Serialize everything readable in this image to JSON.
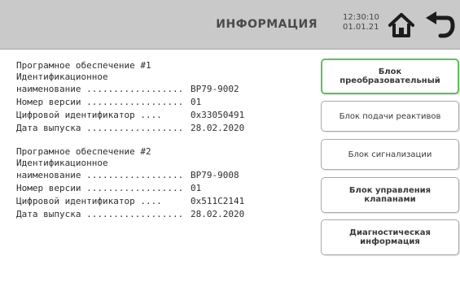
{
  "header": {
    "title": "ИНФОРМАЦИЯ",
    "time": "12:30:10",
    "date": "01.01.21"
  },
  "software": [
    {
      "title": "Програмное обеспечение #1",
      "name_label_line1": "Идентификационное",
      "rows": [
        {
          "label": "наименование ..................",
          "value": "ВР79-9002"
        },
        {
          "label": "Номер версии ..................",
          "value": "01"
        },
        {
          "label": "Цифровой идентификатор ....",
          "value": "0x33050491"
        },
        {
          "label": "Дата выпуска ..................",
          "value": "28.02.2020"
        }
      ]
    },
    {
      "title": "Програмное обеспечение #2",
      "name_label_line1": "Идентификационное",
      "rows": [
        {
          "label": "наименование ..................",
          "value": "ВР79-9008"
        },
        {
          "label": "Номер версии ..................",
          "value": "01"
        },
        {
          "label": "Цифровой идентификатор ....",
          "value": "0x511C2141"
        },
        {
          "label": "Дата выпуска ..................",
          "value": "28.02.2020"
        }
      ]
    }
  ],
  "buttons": {
    "b1": {
      "line1": "Блок",
      "line2": "преобразовательный"
    },
    "b2": {
      "line1": "Блок подачи реактивов"
    },
    "b3": {
      "line1": "Блок сигнализации"
    },
    "b4": {
      "line1": "Блок управления",
      "line2": "клапанами"
    },
    "b5": {
      "line1": "Диагностическая",
      "line2": "информация"
    }
  },
  "icons": {
    "home": "home-icon",
    "back": "back-arrow-icon"
  },
  "colors": {
    "header_bg": "#c9c9c9",
    "active_border": "#5fbf5f"
  }
}
